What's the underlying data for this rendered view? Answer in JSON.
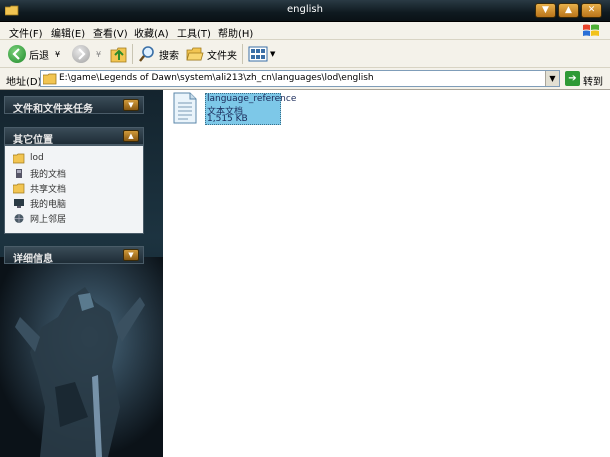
{
  "window": {
    "title": "english"
  },
  "menu": [
    "文件(F)",
    "编辑(E)",
    "查看(V)",
    "收藏(A)",
    "工具(T)",
    "帮助(H)"
  ],
  "toolbar": {
    "back": "后退",
    "search": "搜索",
    "folders": "文件夹"
  },
  "address": {
    "label": "地址(D)",
    "path": "E:\\game\\Legends of Dawn\\system\\ali213\\zh_cn\\languages\\lod\\english",
    "go": "转到"
  },
  "sidebar": {
    "tasks_title": "文件和文件夹任务",
    "other_title": "其它位置",
    "other_items": [
      "lod",
      "我的文档",
      "共享文档",
      "我的电脑",
      "网上邻居"
    ],
    "details_title": "详细信息"
  },
  "files": [
    {
      "name": "language_reference",
      "type": "文本文档",
      "size": "1,515 KB"
    }
  ]
}
